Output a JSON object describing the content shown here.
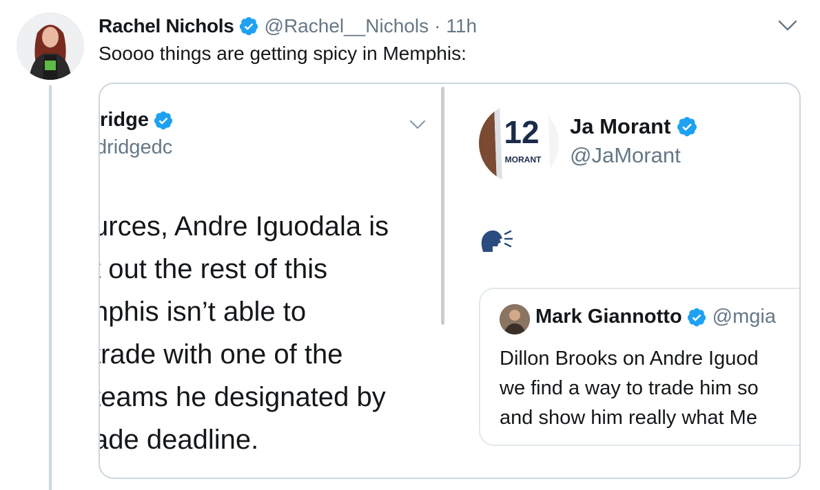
{
  "tweet": {
    "author_name": "Rachel Nichols",
    "author_handle": "@Rachel__Nichols",
    "separator": "·",
    "time": "11h",
    "text": "Soooo things are getting spicy in Memphis:"
  },
  "media": {
    "left_screenshot": {
      "author_name_partial": "ıridge",
      "author_handle_partial": "dridgedc",
      "body_lines": [
        "urces, Andre Iguodala is",
        "t out the rest of this",
        "nphis isn’t able to",
        " trade with one of the",
        " teams he designated by",
        "ade deadline."
      ]
    },
    "right_screenshot": {
      "author_name": "Ja Morant",
      "author_handle": "@JaMorant",
      "jersey_number": "12",
      "jersey_name": "MORANT",
      "emoji": "speaking-head",
      "quoted_tweet": {
        "author_name": "Mark Giannotto",
        "author_handle": "@mgia",
        "text_lines": [
          "Dillon Brooks on Andre Iguod",
          "we find a way to trade him so",
          "and show him really what Me"
        ]
      }
    }
  },
  "colors": {
    "verified": "#1da1f2",
    "secondary_text": "#657786",
    "border": "#ccd6dd",
    "thread_line": "#ccd6dd"
  }
}
